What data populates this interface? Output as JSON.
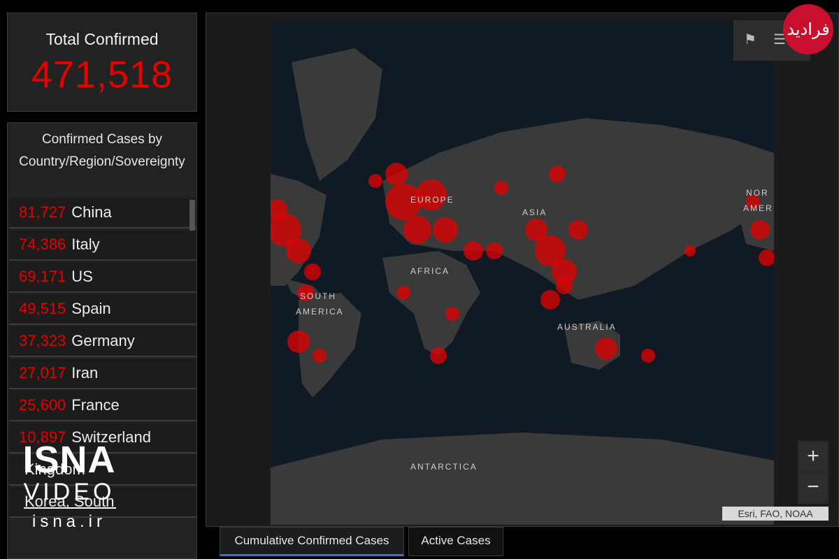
{
  "summary": {
    "label": "Total Confirmed",
    "value": "471,518"
  },
  "list": {
    "title": "Confirmed Cases by Country/Region/Sovereignty",
    "rows": [
      {
        "count": "81,727",
        "country": "China"
      },
      {
        "count": "74,386",
        "country": "Italy"
      },
      {
        "count": "69,171",
        "country": "US"
      },
      {
        "count": "49,515",
        "country": "Spain"
      },
      {
        "count": "37,323",
        "country": "Germany"
      },
      {
        "count": "27,017",
        "country": "Iran"
      },
      {
        "count": "25,600",
        "country": "France"
      },
      {
        "count": "10,897",
        "country": "Switzerland"
      },
      {
        "count": "",
        "country": "Kingdom"
      },
      {
        "count": "",
        "country": "Korea, South"
      }
    ]
  },
  "map": {
    "labels": {
      "europe": "EUROPE",
      "asia": "ASIA",
      "africa": "AFRICA",
      "south_america_1": "SOUTH",
      "south_america_2": "AMERICA",
      "australia": "AUSTRALIA",
      "antarctica": "ANTARCTICA",
      "north_america_1": "NOR",
      "north_america_2": "AMER"
    },
    "attribution": "Esri, FAO, NOAA",
    "zoom_in_label": "+",
    "zoom_out_label": "−",
    "bookmark_icon_glyph": "⚑",
    "list_icon_glyph": "☰"
  },
  "tabs": [
    {
      "label": "Cumulative Confirmed Cases"
    },
    {
      "label": "Active Cases"
    }
  ],
  "watermark": {
    "name": "ISNA",
    "video": "VIDEO",
    "site": "isna.ir"
  },
  "logo_text": "فرادید",
  "colors": {
    "accent_red": "#e60000",
    "tab_active": "#3d6fe0"
  }
}
